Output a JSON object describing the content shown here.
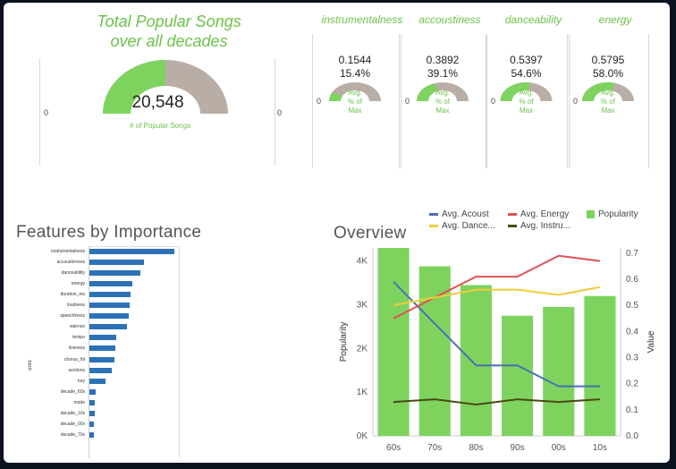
{
  "total": {
    "title_line1": "Total Popular Songs",
    "title_line2": "over all decades",
    "value": "20,548",
    "fraction": 0.5,
    "caption": "# of Popular Songs",
    "min_label": "0",
    "max_label": "0"
  },
  "features": [
    {
      "name": "instrumentalness",
      "value": "0.1544",
      "percent": "15.4%",
      "fraction": 0.154
    },
    {
      "name": "accoustiness",
      "value": "0.3892",
      "percent": "39.1%",
      "fraction": 0.391
    },
    {
      "name": "danceability",
      "value": "0.5397",
      "percent": "54.6%",
      "fraction": 0.546
    },
    {
      "name": "energy",
      "value": "0.5795",
      "percent": "58.0%",
      "fraction": 0.58
    }
  ],
  "gauge_caption": {
    "line1": "Avg.",
    "line2": "% of",
    "line3": "Max"
  },
  "gauge_axis_label": "0",
  "importance": {
    "title": "Features by Importance",
    "ylabel": "ures",
    "items": [
      {
        "label": "instrumentalness",
        "value": 1.0
      },
      {
        "label": "accousticness",
        "value": 0.64
      },
      {
        "label": "danceability",
        "value": 0.6
      },
      {
        "label": "energy",
        "value": 0.5
      },
      {
        "label": "duration_ms",
        "value": 0.48
      },
      {
        "label": "loudness",
        "value": 0.47
      },
      {
        "label": "speechiness",
        "value": 0.46
      },
      {
        "label": "valence",
        "value": 0.44
      },
      {
        "label": "tempo",
        "value": 0.32
      },
      {
        "label": "liveness",
        "value": 0.31
      },
      {
        "label": "chorus_hit",
        "value": 0.29
      },
      {
        "label": "sections",
        "value": 0.26
      },
      {
        "label": "key",
        "value": 0.19
      },
      {
        "label": "decade_60s",
        "value": 0.07
      },
      {
        "label": "mode",
        "value": 0.06
      },
      {
        "label": "decade_10s",
        "value": 0.06
      },
      {
        "label": "decade_00s",
        "value": 0.05
      },
      {
        "label": "decade_70s",
        "value": 0.05
      }
    ]
  },
  "chart_data": {
    "type": "bar",
    "title": "Overview",
    "categories": [
      "60s",
      "70s",
      "80s",
      "90s",
      "00s",
      "10s"
    ],
    "ylabel": "Popularity",
    "y2label": "Value",
    "ylim": [
      0,
      4300
    ],
    "y2lim": [
      0,
      0.72
    ],
    "yticks": [
      "0K",
      "1K",
      "2K",
      "3K",
      "4K"
    ],
    "y2ticks": [
      "0.0",
      "0.1",
      "0.2",
      "0.3",
      "0.4",
      "0.5",
      "0.6",
      "0.7"
    ],
    "colors": {
      "Popularity": "#7ed35f",
      "Avg. Acoust": "#4a72b0",
      "Avg. Energy": "#e05252",
      "Avg. Dance": "#f0cc3a",
      "Avg. Instru": "#4a4a12"
    },
    "legend": [
      "Avg. Acoust",
      "Avg. Energy",
      "Popularity",
      "Avg. Dance...",
      "Avg. Instru..."
    ],
    "series": [
      {
        "name": "Popularity",
        "kind": "bar",
        "values": [
          4300,
          3880,
          3450,
          2750,
          2950,
          3200
        ]
      },
      {
        "name": "Avg. Acoust",
        "kind": "line",
        "values": [
          0.59,
          0.43,
          0.27,
          0.27,
          0.19,
          0.19
        ]
      },
      {
        "name": "Avg. Energy",
        "kind": "line",
        "values": [
          0.45,
          0.53,
          0.61,
          0.61,
          0.69,
          0.67
        ]
      },
      {
        "name": "Avg. Dance",
        "kind": "line",
        "values": [
          0.5,
          0.53,
          0.56,
          0.56,
          0.54,
          0.57
        ]
      },
      {
        "name": "Avg. Instru",
        "kind": "line",
        "values": [
          0.13,
          0.14,
          0.12,
          0.14,
          0.13,
          0.14
        ]
      }
    ]
  }
}
